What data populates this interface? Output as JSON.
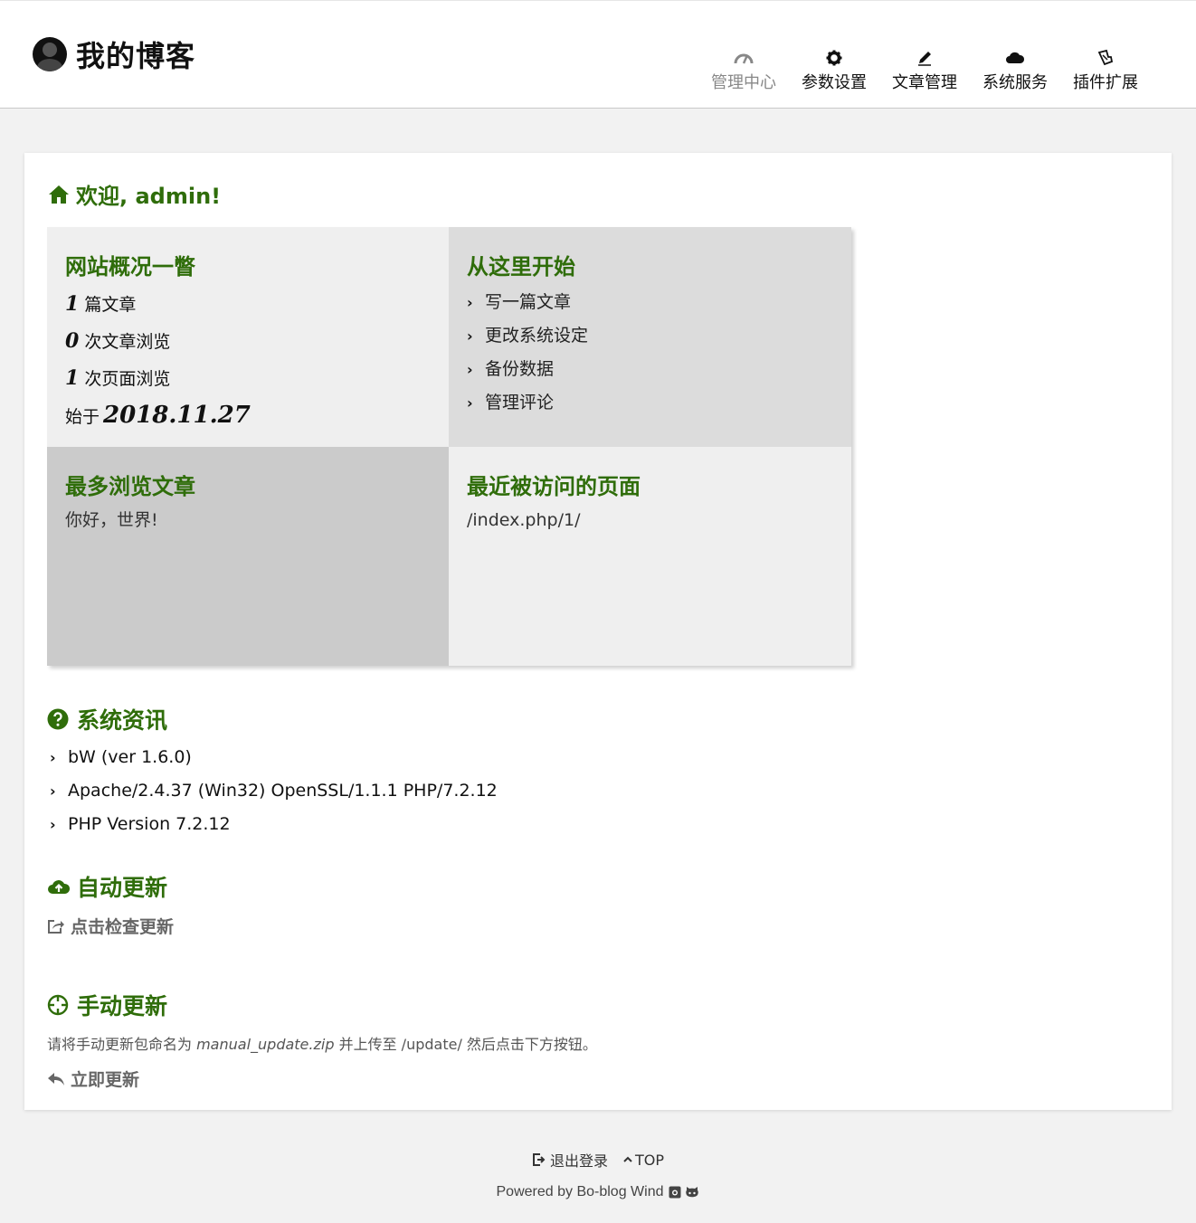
{
  "header": {
    "site_title": "我的博客",
    "nav": [
      {
        "label": "管理中心",
        "icon": "dashboard-icon",
        "active": true
      },
      {
        "label": "参数设置",
        "icon": "gear-icon"
      },
      {
        "label": "文章管理",
        "icon": "pencil-icon"
      },
      {
        "label": "系统服务",
        "icon": "cloud-icon"
      },
      {
        "label": "插件扩展",
        "icon": "puzzle-icon"
      }
    ]
  },
  "welcome": {
    "text": "欢迎, admin!",
    "icon": "home-icon"
  },
  "overview": {
    "title": "网站概况一瞥",
    "posts_num": "1",
    "posts_label": "篇文章",
    "post_views_num": "0",
    "post_views_label": "次文章浏览",
    "page_views_num": "1",
    "page_views_label": "次页面浏览",
    "since_label": "始于",
    "since_date": "2018.11.27"
  },
  "start": {
    "title": "从这里开始",
    "links": [
      "写一篇文章",
      "更改系统设定",
      "备份数据",
      "管理评论"
    ]
  },
  "most_viewed": {
    "title": "最多浏览文章",
    "item": "你好，世界!"
  },
  "recent_visited": {
    "title": "最近被访问的页面",
    "item": "/index.php/1/"
  },
  "system_info": {
    "title": "系统资讯",
    "icon": "question-circle-icon",
    "items": [
      "bW (ver 1.6.0)",
      "Apache/2.4.37 (Win32) OpenSSL/1.1.1 PHP/7.2.12",
      "PHP Version 7.2.12"
    ]
  },
  "auto_update": {
    "title": "自动更新",
    "icon": "cloud-upload-icon",
    "action": "点击检查更新",
    "action_icon": "external-link-icon"
  },
  "manual_update": {
    "title": "手动更新",
    "icon": "crosshair-icon",
    "note_prefix": "请将手动更新包命名为 ",
    "note_file": "manual_update.zip",
    "note_middle": " 并上传至 ",
    "note_path": "/update/",
    "note_suffix": " 然后点击下方按钮。",
    "action": "立即更新",
    "action_icon": "reply-icon"
  },
  "footer": {
    "logout": "退出登录",
    "top": "TOP",
    "powered": "Powered by Bo-blog Wind"
  }
}
